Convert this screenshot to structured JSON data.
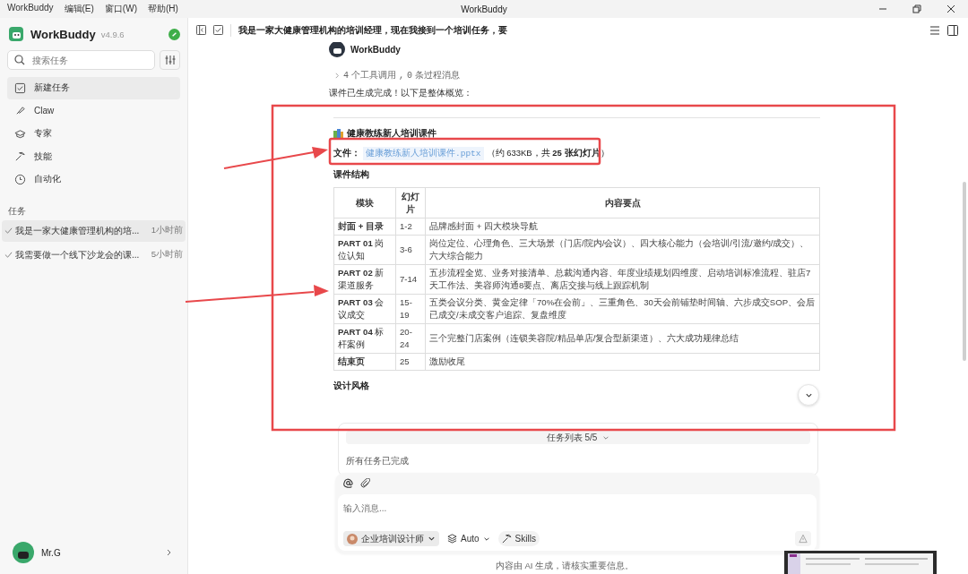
{
  "window": {
    "title": "WorkBuddy",
    "menu": [
      "WorkBuddy",
      "编辑(E)",
      "窗口(W)",
      "帮助(H)"
    ]
  },
  "sidebar": {
    "app_name": "WorkBuddy",
    "version": "v4.9.6",
    "search": {
      "placeholder": "搜索任务"
    },
    "nav": [
      {
        "label": "新建任务",
        "selected": true
      },
      {
        "label": "Claw",
        "selected": false
      },
      {
        "label": "专家",
        "selected": false
      },
      {
        "label": "技能",
        "selected": false
      },
      {
        "label": "自动化",
        "selected": false
      }
    ],
    "section_label": "任务",
    "tasks": [
      {
        "title": "我是一家大健康管理机构的培...",
        "time": "1小时前",
        "selected": true
      },
      {
        "title": "我需要做一个线下沙龙会的课...",
        "time": "5小时前",
        "selected": false
      }
    ],
    "user": {
      "name": "Mr.G"
    }
  },
  "header": {
    "title": "我是一家大健康管理机构的培训经理，现在我接到一个培训任务，要"
  },
  "message": {
    "sender": "WorkBuddy",
    "process": {
      "tool_count": "4",
      "tool_label": "个工具调用",
      "separator": ",",
      "msg_count": "0",
      "msg_label": "条过程消息"
    },
    "intro": "课件已生成完成！以下是整体概览：",
    "doc_title": "健康教练新人培训课件",
    "file": {
      "label": "文件：",
      "name": "健康教练新人培训课件.pptx",
      "meta": "（约 633KB，共 **25 张幻灯片**）"
    },
    "structure_heading": "课件结构",
    "table": {
      "columns": [
        "模块",
        "幻灯片",
        "内容要点"
      ],
      "rows": [
        [
          "**封面 + 目录**",
          "1-2",
          "品牌感封面 + 四大模块导航"
        ],
        [
          "**PART 01** 岗位认知",
          "3-6",
          "岗位定位、心理角色、三大场景（门店/院内/会议）、四大核心能力（会培训/引流/邀约/成交）、六大综合能力"
        ],
        [
          "**PART 02** 新渠道服务",
          "7-14",
          "五步流程全览、业务对接清单、总裁沟通内容、年度业绩规划四维度、启动培训标准流程、驻店7天工作法、美容师沟通8要点、离店交接与线上跟踪机制"
        ],
        [
          "**PART 03** 会议成交",
          "15-19",
          "五类会议分类、黄金定律「70%在会前」、三重角色、30天会前铺垫时间轴、六步成交SOP、会后已成交/未成交客户追踪、复盘维度"
        ],
        [
          "**PART 04** 标杆案例",
          "20-24",
          "三个完整门店案例（连锁美容院/精品单店/复合型新渠道）、六大成功规律总结"
        ],
        [
          "**结束页**",
          "25",
          "激励收尾"
        ]
      ]
    },
    "style_heading": "设计风格"
  },
  "task_list": {
    "title": "任务列表 5/5",
    "status": "所有任务已完成"
  },
  "composer": {
    "placeholder": "输入消息...",
    "agent": "企业培训设计师",
    "model": "Auto",
    "skills": "Skills"
  },
  "footer_note": "内容由 AI 生成，请核实重要信息。"
}
